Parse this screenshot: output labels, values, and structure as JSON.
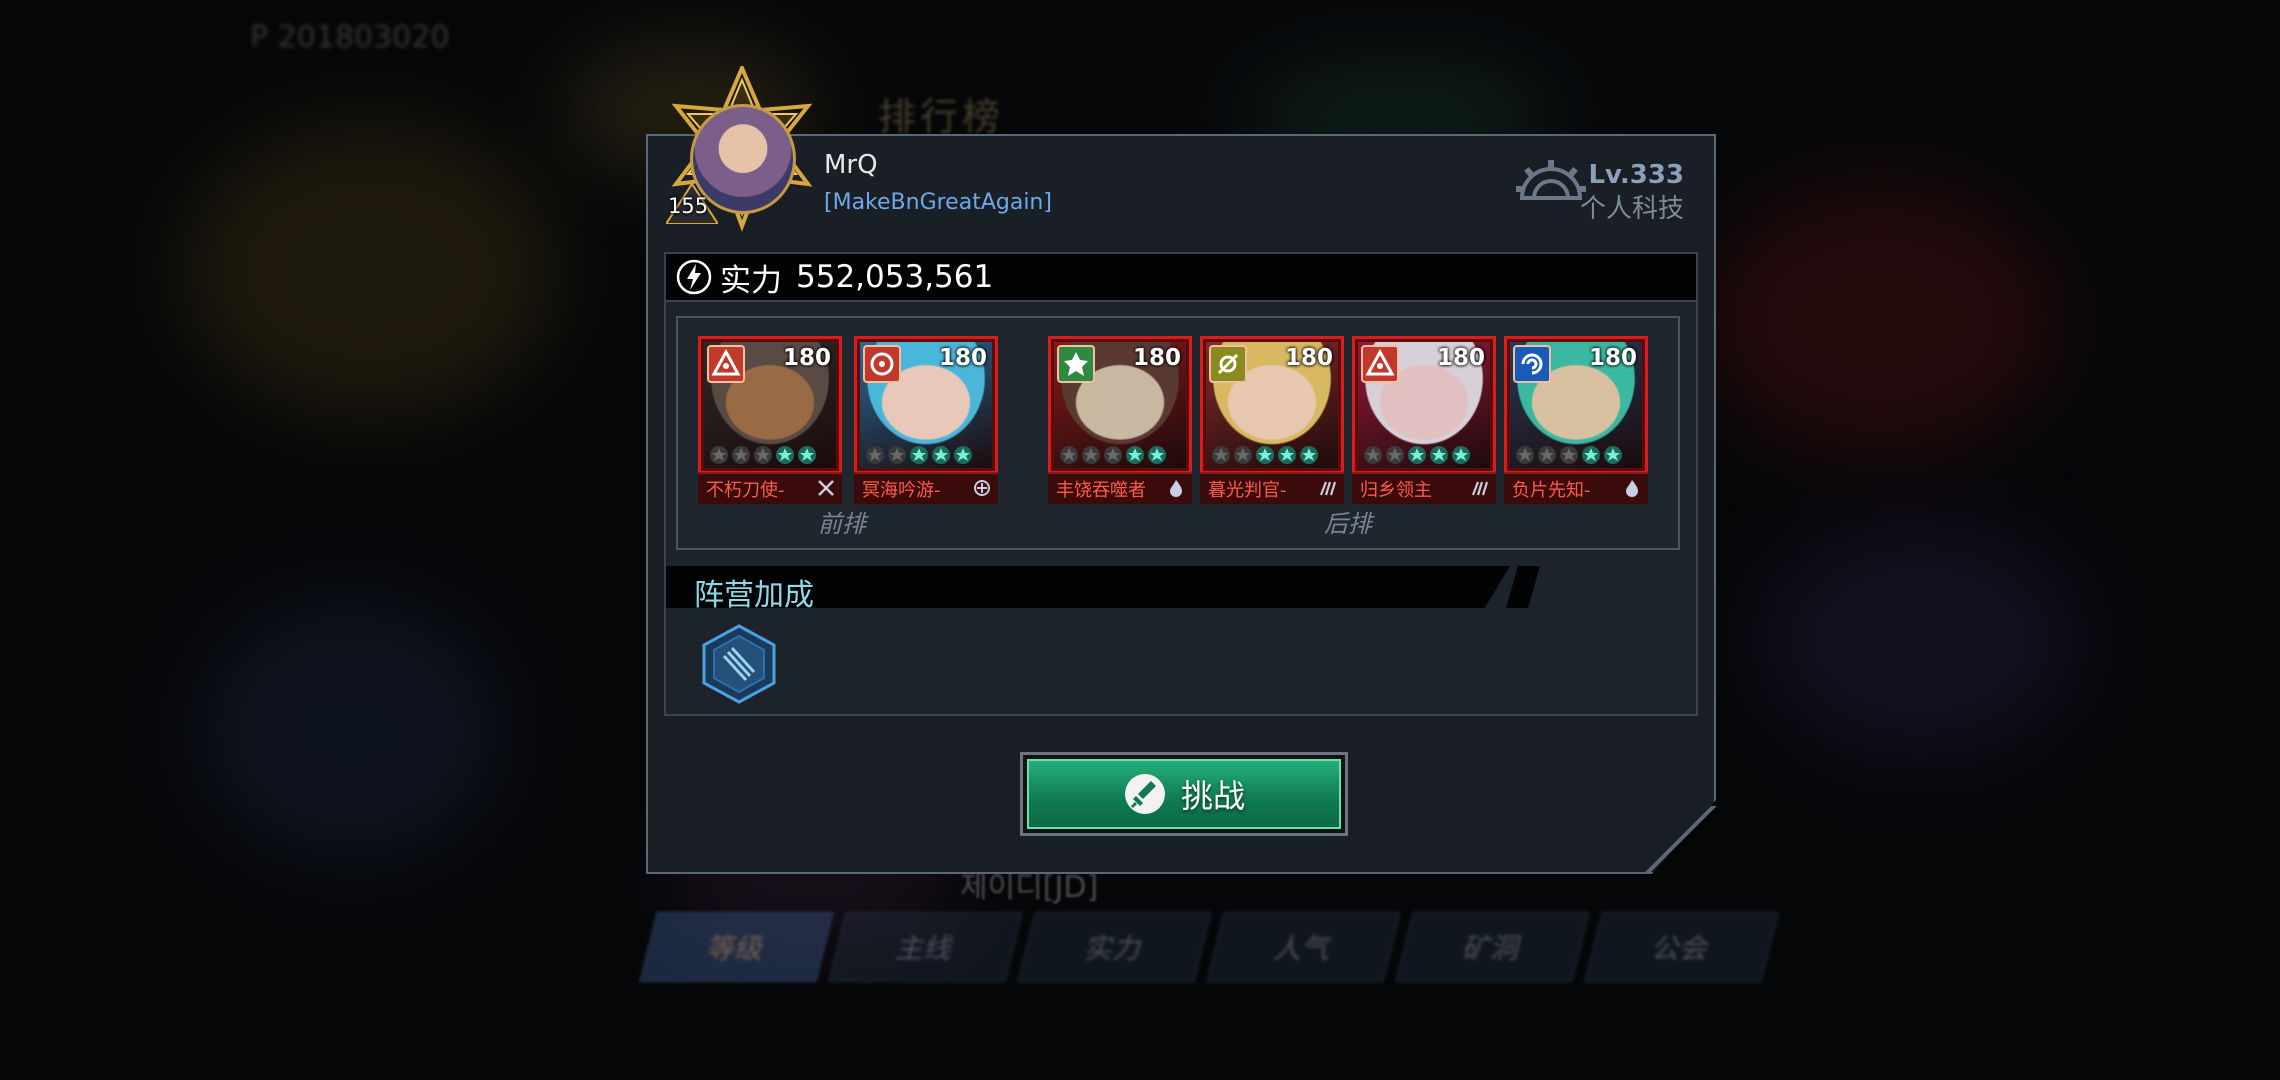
{
  "background": {
    "leaderboard_title": "排行榜",
    "player_id_text": "P 201803020",
    "below_player_text": "제이디[JD]",
    "tabs": [
      {
        "label": "等级",
        "active": true
      },
      {
        "label": "主线",
        "active": false
      },
      {
        "label": "实力",
        "active": false
      },
      {
        "label": "人气",
        "active": false
      },
      {
        "label": "矿洞",
        "active": false
      },
      {
        "label": "公会",
        "active": false
      }
    ]
  },
  "player": {
    "avatar_level": "155",
    "name": "MrQ",
    "guild": "[MakeBnGreatAgain]",
    "tech_level": "Lv.333",
    "tech_label": "个人科技"
  },
  "power": {
    "label": "实力",
    "value": "552,053,561"
  },
  "lineup": {
    "front_label": "前排",
    "back_label": "后排",
    "heroes": [
      {
        "name": "不朽刀使-",
        "level": "180",
        "faction_color": "#c0392b",
        "faction_icon": "triforce-icon",
        "class_icon": "swords-icon",
        "stars_lit": 2,
        "portrait_colors": [
          "#5a4a44",
          "#9a6a44",
          "#2e2a2a"
        ]
      },
      {
        "name": "冥海吟游-",
        "level": "180",
        "faction_color": "#c0392b",
        "faction_icon": "target-icon",
        "class_icon": "support-icon",
        "stars_lit": 3,
        "portrait_colors": [
          "#4ab6d8",
          "#e8c8b8",
          "#2c6a98"
        ]
      },
      {
        "name": "丰饶吞噬者",
        "level": "180",
        "faction_color": "#2e8a40",
        "faction_icon": "nature-icon",
        "class_icon": "fire-icon",
        "stars_lit": 2,
        "portrait_colors": [
          "#5a3a30",
          "#c8b8a0",
          "#8a1a1a"
        ]
      },
      {
        "name": "暮光判官-",
        "level": "180",
        "faction_color": "#8a8a20",
        "faction_icon": "sun-icon",
        "class_icon": "claw-icon",
        "stars_lit": 3,
        "portrait_colors": [
          "#d8b860",
          "#e8c8b0",
          "#8a2a2a"
        ]
      },
      {
        "name": "归乡领主",
        "level": "180",
        "faction_color": "#c0392b",
        "faction_icon": "triforce-icon",
        "class_icon": "claw-icon",
        "stars_lit": 3,
        "portrait_colors": [
          "#d8d0d8",
          "#e0c0c0",
          "#9a1a3a"
        ]
      },
      {
        "name": "负片先知-",
        "level": "180",
        "faction_color": "#1a5ab8",
        "faction_icon": "swirl-icon",
        "class_icon": "fire-icon",
        "stars_lit": 2,
        "portrait_colors": [
          "#3ab8a0",
          "#d8c0a0",
          "#2a3a58"
        ]
      }
    ]
  },
  "faction_bonus": {
    "title": "阵营加成",
    "icon": "faction-bonus-icon"
  },
  "challenge_button": {
    "label": "挑战",
    "icon": "sword-icon"
  },
  "colors": {
    "accent_green": "#0f7a50",
    "hero_border_red": "#d91c1c",
    "guild_blue": "#6fa8e6",
    "faction_title": "#8fd8e8"
  }
}
